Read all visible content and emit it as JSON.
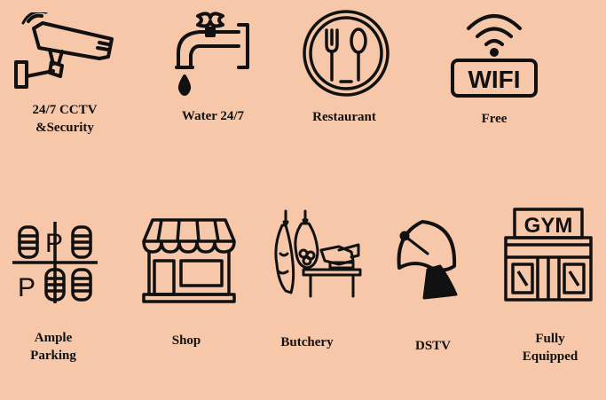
{
  "colors": {
    "background": "#f6c7a9",
    "icon_stroke": "#111111"
  },
  "amenities": [
    {
      "icon": "cctv-camera-icon",
      "label_lines": [
        "24/7 CCTV",
        "&Security"
      ]
    },
    {
      "icon": "water-tap-icon",
      "label_lines": [
        "Water 24/7"
      ]
    },
    {
      "icon": "restaurant-icon",
      "label_lines": [
        "Restaurant"
      ]
    },
    {
      "icon": "wifi-icon",
      "label_lines": [
        "Free"
      ],
      "icon_text": "WIFI"
    },
    {
      "icon": "parking-icon",
      "label_lines": [
        "Ample",
        "Parking"
      ],
      "icon_text": "P"
    },
    {
      "icon": "shop-icon",
      "label_lines": [
        "Shop"
      ]
    },
    {
      "icon": "butchery-icon",
      "label_lines": [
        "Butchery"
      ]
    },
    {
      "icon": "satellite-dish-icon",
      "label_lines": [
        "DSTV"
      ]
    },
    {
      "icon": "gym-icon",
      "label_lines": [
        "Fully",
        "Equipped"
      ],
      "icon_text": "GYM"
    }
  ]
}
